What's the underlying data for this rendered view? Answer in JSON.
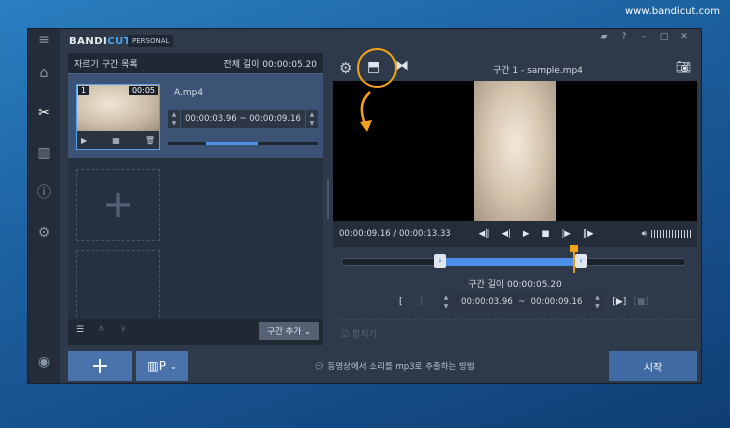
{
  "site": "www.bandicut.com",
  "app": {
    "logo_a": "BANDI",
    "logo_b": "CUT",
    "edition": "PERSONAL"
  },
  "left_panel": {
    "title": "자르기 구간 목록",
    "total_label": "전체 길이 00:00:05.20",
    "clip": {
      "index": "1",
      "duration": "00:05",
      "filename": "A.mp4",
      "start": "00:00:03.96",
      "sep": "~",
      "end": "00:00:09.16",
      "progress": 0.35
    },
    "add_segment": "구간 추가"
  },
  "player": {
    "title": "구간 1 - sample.mp4",
    "time": "00:00:09.16 / 00:00:13.33",
    "segment_length": "구간 길이 00:00:05.20",
    "start": "00:00:03.96",
    "sep": "~",
    "end": "00:00:09.16",
    "merge": "합치기"
  },
  "bottom": {
    "hint": "동영상에서 소리를 mp3로 추출하는 방법",
    "start": "시작"
  },
  "colors": {
    "accent": "#4a90e8",
    "highlight": "#f2a21b"
  }
}
